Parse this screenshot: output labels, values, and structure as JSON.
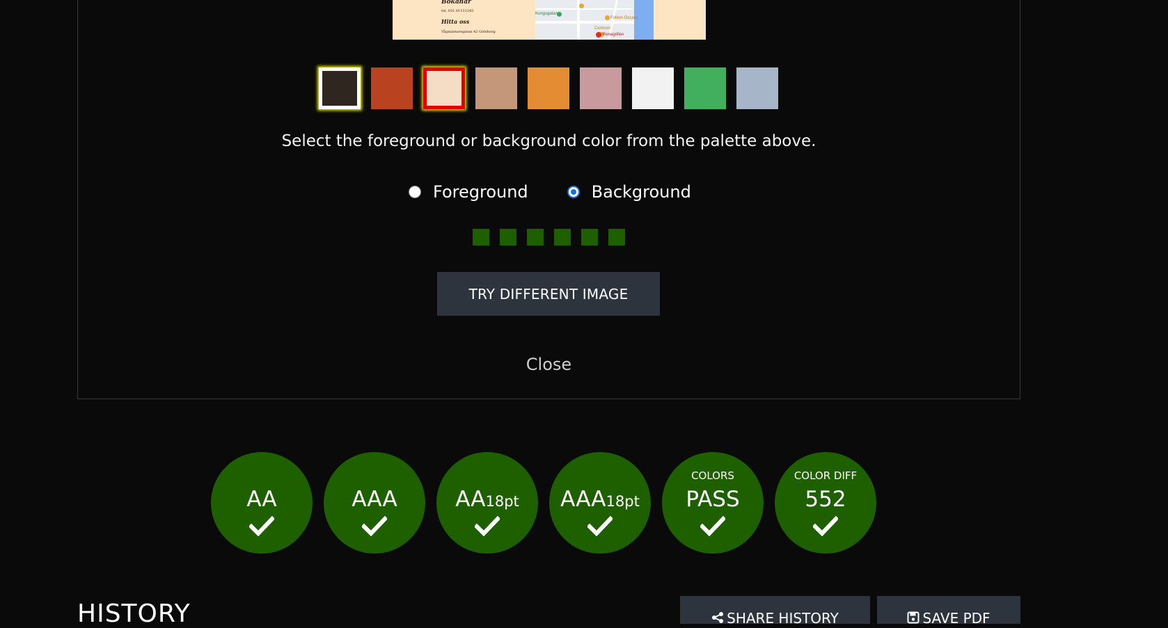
{
  "preview": {
    "menu_lines": [
      "Bokahar",
      "tel. 031 81131245",
      "Hitta oss",
      "Vågmästaregatan 42 Göteborg"
    ],
    "map_labels": {
      "a": "Kungsgatan",
      "b": "Folken Oscara",
      "c": "Centrum",
      "d": "Renagrillen"
    }
  },
  "palette": {
    "swatches": [
      {
        "color": "#2f2620",
        "state": "foreground"
      },
      {
        "color": "#b94220",
        "state": "none"
      },
      {
        "color": "#f5dcc4",
        "state": "background"
      },
      {
        "color": "#c4967a",
        "state": "none"
      },
      {
        "color": "#e48c34",
        "state": "none"
      },
      {
        "color": "#c89a9e",
        "state": "none"
      },
      {
        "color": "#f2f2f2",
        "state": "none"
      },
      {
        "color": "#42af5e",
        "state": "none"
      },
      {
        "color": "#a6b5c7",
        "state": "none"
      }
    ]
  },
  "instruction": "Select the foreground or background color from the palette above.",
  "radios": {
    "foreground_label": "Foreground",
    "background_label": "Background",
    "selected": "background"
  },
  "progress_dots": {
    "count": 6,
    "color": "#1e6000"
  },
  "try_button_label": "TRY DIFFERENT IMAGE",
  "close_label": "Close",
  "results": [
    {
      "small": "",
      "main": "AA",
      "sub": "",
      "status": "pass",
      "icon": "check-icon"
    },
    {
      "small": "",
      "main": "AAA",
      "sub": "",
      "status": "pass",
      "icon": "check-icon"
    },
    {
      "small": "",
      "main": "AA",
      "sub": "18pt",
      "status": "pass",
      "icon": "check-icon"
    },
    {
      "small": "",
      "main": "AAA",
      "sub": "18pt",
      "status": "pass",
      "icon": "check-icon"
    },
    {
      "small": "COLORS",
      "main": "PASS",
      "sub": "",
      "status": "pass",
      "icon": "check-icon"
    },
    {
      "small": "COLOR DIFF",
      "main": "552",
      "sub": "",
      "status": "pass",
      "icon": "check-icon"
    }
  ],
  "history": {
    "title": "HISTORY",
    "share_label": "SHARE HISTORY",
    "save_label": "SAVE PDF"
  }
}
